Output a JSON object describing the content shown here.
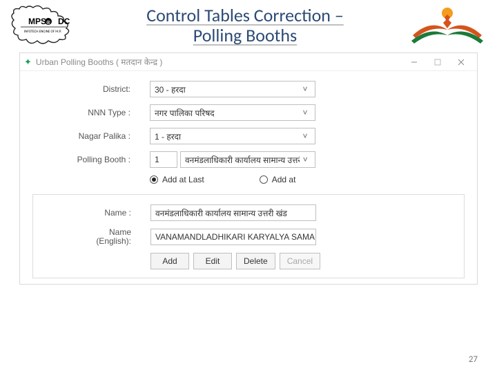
{
  "header": {
    "title_line1": "Control Tables Correction –",
    "title_line2": "Polling Booths",
    "left_logo_text": "MPS@DC",
    "left_logo_sub": "INFOTECH ENGINE OF M.P."
  },
  "window": {
    "title": "Urban Polling Booths ( मतदान केन्द्र )"
  },
  "form": {
    "district_label": "District:",
    "district_value": "30 - हरदा",
    "nnn_type_label": "NNN Type :",
    "nnn_type_value": "नगर पालिका परिषद",
    "nagar_palika_label": "Nagar Palika :",
    "nagar_palika_value": "1 - हरदा",
    "polling_booth_label": "Polling Booth :",
    "polling_booth_num": "1",
    "polling_booth_value": "वनमंडलाधिकारी कार्यालय सामान्य उत्तरी",
    "radio_add_last": "Add at Last",
    "radio_add_at": "Add at"
  },
  "panel": {
    "name_label": "Name :",
    "name_value": "वनमंडलाधिकारी कार्यालय सामान्य उत्तरी खंड",
    "name_en_label_1": "Name",
    "name_en_label_2": "(English):",
    "name_en_value": "VANAMANDLADHIKARI KARYALYA SAMAN",
    "btn_add": "Add",
    "btn_edit": "Edit",
    "btn_delete": "Delete",
    "btn_cancel": "Cancel"
  },
  "footer": {
    "strip": "",
    "page": "27"
  }
}
